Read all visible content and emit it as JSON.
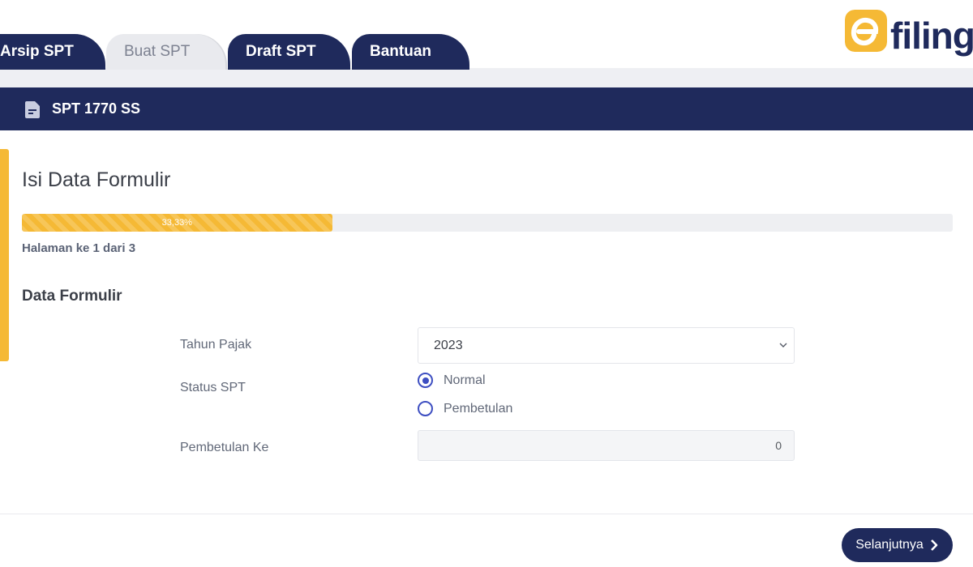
{
  "tabs": [
    {
      "label": "Arsip SPT",
      "active": false
    },
    {
      "label": "Buat SPT",
      "active": true
    },
    {
      "label": "Draft SPT",
      "active": false
    },
    {
      "label": "Bantuan",
      "active": false
    }
  ],
  "logo": {
    "mark": "e",
    "text": "filing"
  },
  "header": {
    "title": "SPT 1770 SS",
    "icon": "document-icon"
  },
  "form_section": {
    "title": "Isi Data Formulir",
    "progress": {
      "percent": 33.33,
      "label": "33,33%"
    },
    "page_indicator": "Halaman ke 1 dari 3",
    "subtitle": "Data Formulir"
  },
  "fields": {
    "tahun_pajak": {
      "label": "Tahun Pajak",
      "value": "2023"
    },
    "status_spt": {
      "label": "Status SPT",
      "options": [
        {
          "label": "Normal",
          "checked": true
        },
        {
          "label": "Pembetulan",
          "checked": false
        }
      ]
    },
    "pembetulan_ke": {
      "label": "Pembetulan Ke",
      "value": "0"
    }
  },
  "actions": {
    "next_label": "Selanjutnya"
  },
  "colors": {
    "navy": "#1f2a5c",
    "accent": "#f5b935",
    "radio": "#3d4ec1"
  }
}
